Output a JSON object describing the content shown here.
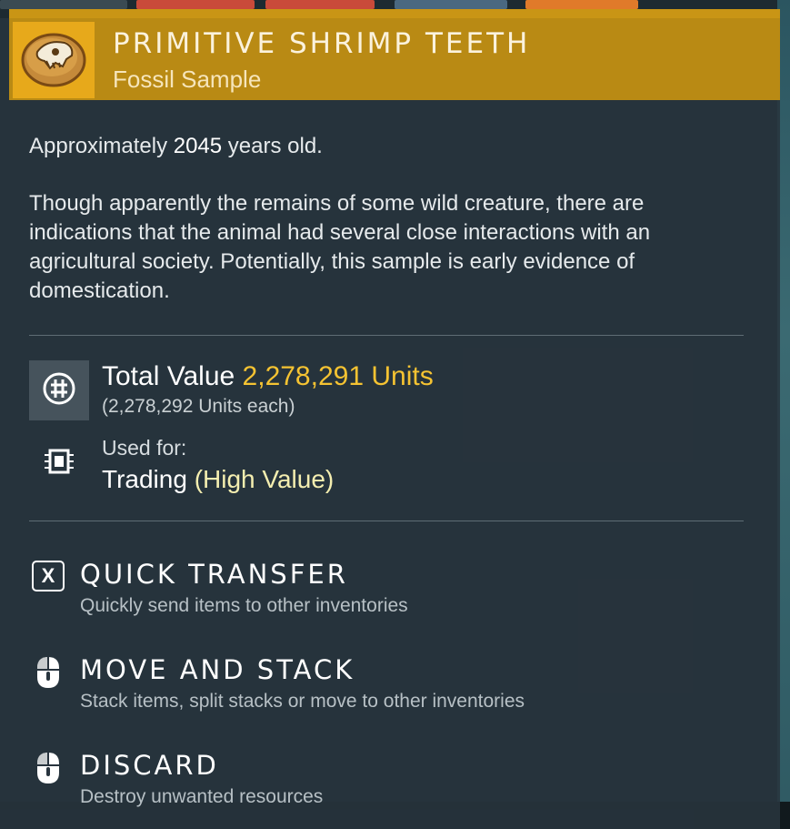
{
  "item": {
    "name": "PRIMITIVE SHRIMP TEETH",
    "category": "Fossil Sample",
    "icon": "fossil-skull-icon"
  },
  "description": {
    "age_prefix": "Approximately ",
    "age_value": "2045",
    "age_suffix": " years old.",
    "body": "Though apparently the remains of some wild creature, there are indications that the animal had several close interactions with an agricultural society. Potentially, this sample is early evidence of domestication."
  },
  "value": {
    "label": "Total Value ",
    "amount": "2,278,291 Units",
    "each": "(2,278,292 Units each)",
    "icon": "units-currency-icon"
  },
  "usage": {
    "label": "Used for:",
    "value": "Trading ",
    "highlight": "(High Value)",
    "icon": "chip-icon"
  },
  "actions": [
    {
      "key": "X",
      "title": "QUICK TRANSFER",
      "desc": "Quickly send items to other inventories",
      "icon": "x-key-icon"
    },
    {
      "title": "MOVE AND STACK",
      "desc": "Stack items, split stacks or move to other inventories",
      "icon": "mouse-left-icon"
    },
    {
      "title": "DISCARD",
      "desc": "Destroy unwanted resources",
      "icon": "mouse-left-icon"
    }
  ],
  "colors": {
    "header": "#b98a14",
    "icon_bg": "#e7a91b",
    "value_amount": "#f5c332",
    "highlight": "#f4eeb0"
  }
}
